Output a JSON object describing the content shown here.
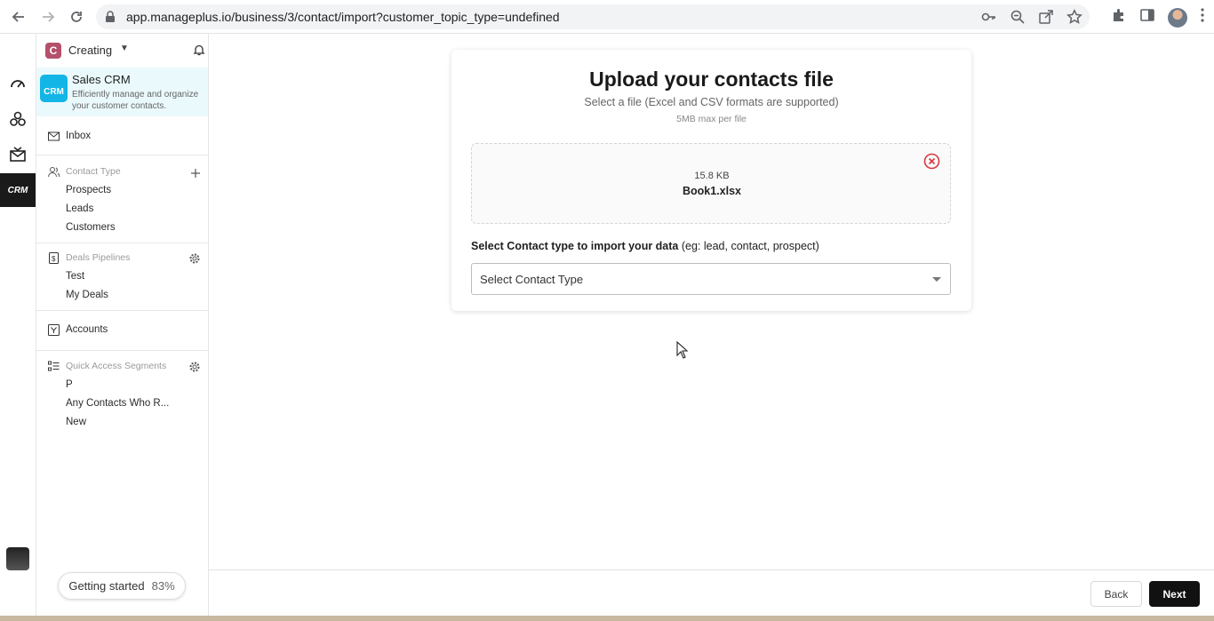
{
  "browser": {
    "url": "app.manageplus.io/business/3/contact/import?customer_topic_type=undefined"
  },
  "sidebar": {
    "workspace_initial": "C",
    "workspace_name": "Creating",
    "app_card": {
      "logo_text": "CRM",
      "title": "Sales CRM",
      "description": "Efficiently manage and organize your customer contacts."
    },
    "inbox_label": "Inbox",
    "contact_type": {
      "heading": "Contact Type",
      "items": [
        "Prospects",
        "Leads",
        "Customers"
      ]
    },
    "deals_pipelines": {
      "heading": "Deals Pipelines",
      "items": [
        "Test",
        "My Deals"
      ]
    },
    "accounts_label": "Accounts",
    "segments": {
      "heading": "Quick Access Segments",
      "items": [
        "P",
        "Any Contacts Who R...",
        "New"
      ]
    },
    "getting_started": {
      "label": "Getting started",
      "percent": "83%"
    }
  },
  "rail": {
    "active_label": "CRM"
  },
  "upload": {
    "title": "Upload your contacts file",
    "subtitle": "Select a file (Excel and CSV formats are supported)",
    "limit": "5MB max per file",
    "file_size": "15.8 KB",
    "file_name": "Book1.xlsx",
    "select_label_bold": "Select Contact type to import your data",
    "select_label_hint": "(eg: lead, contact, prospect)",
    "select_placeholder": "Select Contact Type"
  },
  "footer": {
    "back_label": "Back",
    "next_label": "Next"
  },
  "colors": {
    "accent": "#12b5e6",
    "workspace_badge": "#b5506a",
    "remove_icon": "#d9363e",
    "primary_button": "#111111"
  }
}
